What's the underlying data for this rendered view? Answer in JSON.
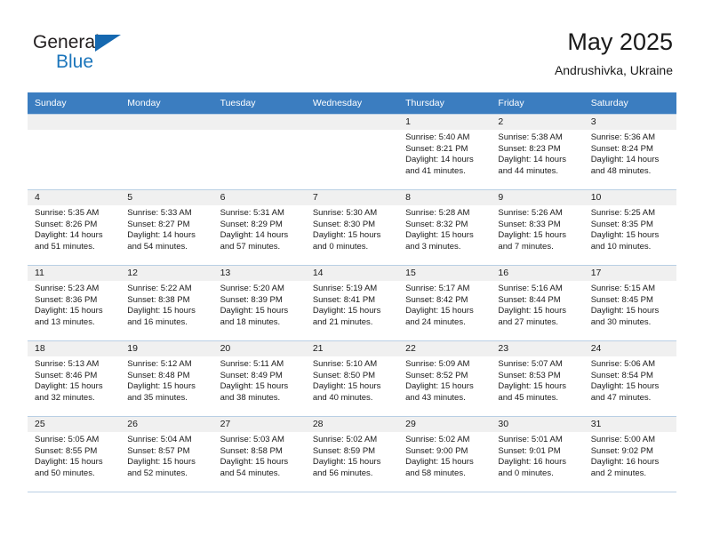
{
  "brand": {
    "name_part1": "General",
    "name_part2": "Blue",
    "accent_color": "#1b75bb",
    "triangle_color": "#1568b0"
  },
  "header": {
    "title": "May 2025",
    "subtitle": "Andrushivka, Ukraine"
  },
  "theme": {
    "header_row_bg": "#3b7dc0",
    "daynum_bg": "#f0f0f0",
    "grid_line": "#b9cfe4"
  },
  "weekday_headers": [
    "Sunday",
    "Monday",
    "Tuesday",
    "Wednesday",
    "Thursday",
    "Friday",
    "Saturday"
  ],
  "weeks": [
    [
      {
        "day": "",
        "sunrise": "",
        "sunset": "",
        "daylight_line1": "",
        "daylight_line2": ""
      },
      {
        "day": "",
        "sunrise": "",
        "sunset": "",
        "daylight_line1": "",
        "daylight_line2": ""
      },
      {
        "day": "",
        "sunrise": "",
        "sunset": "",
        "daylight_line1": "",
        "daylight_line2": ""
      },
      {
        "day": "",
        "sunrise": "",
        "sunset": "",
        "daylight_line1": "",
        "daylight_line2": ""
      },
      {
        "day": "1",
        "sunrise": "Sunrise: 5:40 AM",
        "sunset": "Sunset: 8:21 PM",
        "daylight_line1": "Daylight: 14 hours",
        "daylight_line2": "and 41 minutes."
      },
      {
        "day": "2",
        "sunrise": "Sunrise: 5:38 AM",
        "sunset": "Sunset: 8:23 PM",
        "daylight_line1": "Daylight: 14 hours",
        "daylight_line2": "and 44 minutes."
      },
      {
        "day": "3",
        "sunrise": "Sunrise: 5:36 AM",
        "sunset": "Sunset: 8:24 PM",
        "daylight_line1": "Daylight: 14 hours",
        "daylight_line2": "and 48 minutes."
      }
    ],
    [
      {
        "day": "4",
        "sunrise": "Sunrise: 5:35 AM",
        "sunset": "Sunset: 8:26 PM",
        "daylight_line1": "Daylight: 14 hours",
        "daylight_line2": "and 51 minutes."
      },
      {
        "day": "5",
        "sunrise": "Sunrise: 5:33 AM",
        "sunset": "Sunset: 8:27 PM",
        "daylight_line1": "Daylight: 14 hours",
        "daylight_line2": "and 54 minutes."
      },
      {
        "day": "6",
        "sunrise": "Sunrise: 5:31 AM",
        "sunset": "Sunset: 8:29 PM",
        "daylight_line1": "Daylight: 14 hours",
        "daylight_line2": "and 57 minutes."
      },
      {
        "day": "7",
        "sunrise": "Sunrise: 5:30 AM",
        "sunset": "Sunset: 8:30 PM",
        "daylight_line1": "Daylight: 15 hours",
        "daylight_line2": "and 0 minutes."
      },
      {
        "day": "8",
        "sunrise": "Sunrise: 5:28 AM",
        "sunset": "Sunset: 8:32 PM",
        "daylight_line1": "Daylight: 15 hours",
        "daylight_line2": "and 3 minutes."
      },
      {
        "day": "9",
        "sunrise": "Sunrise: 5:26 AM",
        "sunset": "Sunset: 8:33 PM",
        "daylight_line1": "Daylight: 15 hours",
        "daylight_line2": "and 7 minutes."
      },
      {
        "day": "10",
        "sunrise": "Sunrise: 5:25 AM",
        "sunset": "Sunset: 8:35 PM",
        "daylight_line1": "Daylight: 15 hours",
        "daylight_line2": "and 10 minutes."
      }
    ],
    [
      {
        "day": "11",
        "sunrise": "Sunrise: 5:23 AM",
        "sunset": "Sunset: 8:36 PM",
        "daylight_line1": "Daylight: 15 hours",
        "daylight_line2": "and 13 minutes."
      },
      {
        "day": "12",
        "sunrise": "Sunrise: 5:22 AM",
        "sunset": "Sunset: 8:38 PM",
        "daylight_line1": "Daylight: 15 hours",
        "daylight_line2": "and 16 minutes."
      },
      {
        "day": "13",
        "sunrise": "Sunrise: 5:20 AM",
        "sunset": "Sunset: 8:39 PM",
        "daylight_line1": "Daylight: 15 hours",
        "daylight_line2": "and 18 minutes."
      },
      {
        "day": "14",
        "sunrise": "Sunrise: 5:19 AM",
        "sunset": "Sunset: 8:41 PM",
        "daylight_line1": "Daylight: 15 hours",
        "daylight_line2": "and 21 minutes."
      },
      {
        "day": "15",
        "sunrise": "Sunrise: 5:17 AM",
        "sunset": "Sunset: 8:42 PM",
        "daylight_line1": "Daylight: 15 hours",
        "daylight_line2": "and 24 minutes."
      },
      {
        "day": "16",
        "sunrise": "Sunrise: 5:16 AM",
        "sunset": "Sunset: 8:44 PM",
        "daylight_line1": "Daylight: 15 hours",
        "daylight_line2": "and 27 minutes."
      },
      {
        "day": "17",
        "sunrise": "Sunrise: 5:15 AM",
        "sunset": "Sunset: 8:45 PM",
        "daylight_line1": "Daylight: 15 hours",
        "daylight_line2": "and 30 minutes."
      }
    ],
    [
      {
        "day": "18",
        "sunrise": "Sunrise: 5:13 AM",
        "sunset": "Sunset: 8:46 PM",
        "daylight_line1": "Daylight: 15 hours",
        "daylight_line2": "and 32 minutes."
      },
      {
        "day": "19",
        "sunrise": "Sunrise: 5:12 AM",
        "sunset": "Sunset: 8:48 PM",
        "daylight_line1": "Daylight: 15 hours",
        "daylight_line2": "and 35 minutes."
      },
      {
        "day": "20",
        "sunrise": "Sunrise: 5:11 AM",
        "sunset": "Sunset: 8:49 PM",
        "daylight_line1": "Daylight: 15 hours",
        "daylight_line2": "and 38 minutes."
      },
      {
        "day": "21",
        "sunrise": "Sunrise: 5:10 AM",
        "sunset": "Sunset: 8:50 PM",
        "daylight_line1": "Daylight: 15 hours",
        "daylight_line2": "and 40 minutes."
      },
      {
        "day": "22",
        "sunrise": "Sunrise: 5:09 AM",
        "sunset": "Sunset: 8:52 PM",
        "daylight_line1": "Daylight: 15 hours",
        "daylight_line2": "and 43 minutes."
      },
      {
        "day": "23",
        "sunrise": "Sunrise: 5:07 AM",
        "sunset": "Sunset: 8:53 PM",
        "daylight_line1": "Daylight: 15 hours",
        "daylight_line2": "and 45 minutes."
      },
      {
        "day": "24",
        "sunrise": "Sunrise: 5:06 AM",
        "sunset": "Sunset: 8:54 PM",
        "daylight_line1": "Daylight: 15 hours",
        "daylight_line2": "and 47 minutes."
      }
    ],
    [
      {
        "day": "25",
        "sunrise": "Sunrise: 5:05 AM",
        "sunset": "Sunset: 8:55 PM",
        "daylight_line1": "Daylight: 15 hours",
        "daylight_line2": "and 50 minutes."
      },
      {
        "day": "26",
        "sunrise": "Sunrise: 5:04 AM",
        "sunset": "Sunset: 8:57 PM",
        "daylight_line1": "Daylight: 15 hours",
        "daylight_line2": "and 52 minutes."
      },
      {
        "day": "27",
        "sunrise": "Sunrise: 5:03 AM",
        "sunset": "Sunset: 8:58 PM",
        "daylight_line1": "Daylight: 15 hours",
        "daylight_line2": "and 54 minutes."
      },
      {
        "day": "28",
        "sunrise": "Sunrise: 5:02 AM",
        "sunset": "Sunset: 8:59 PM",
        "daylight_line1": "Daylight: 15 hours",
        "daylight_line2": "and 56 minutes."
      },
      {
        "day": "29",
        "sunrise": "Sunrise: 5:02 AM",
        "sunset": "Sunset: 9:00 PM",
        "daylight_line1": "Daylight: 15 hours",
        "daylight_line2": "and 58 minutes."
      },
      {
        "day": "30",
        "sunrise": "Sunrise: 5:01 AM",
        "sunset": "Sunset: 9:01 PM",
        "daylight_line1": "Daylight: 16 hours",
        "daylight_line2": "and 0 minutes."
      },
      {
        "day": "31",
        "sunrise": "Sunrise: 5:00 AM",
        "sunset": "Sunset: 9:02 PM",
        "daylight_line1": "Daylight: 16 hours",
        "daylight_line2": "and 2 minutes."
      }
    ]
  ]
}
